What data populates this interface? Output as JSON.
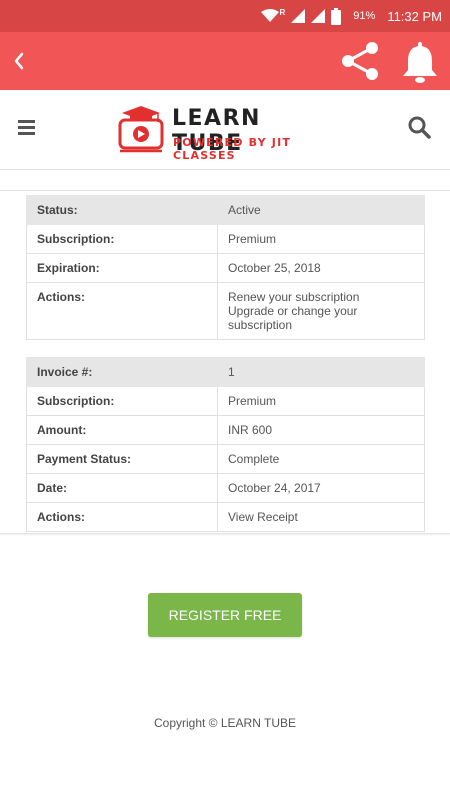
{
  "status_bar": {
    "battery": "91%",
    "time": "11:32 PM",
    "network_badge": "R"
  },
  "app_bar": {
    "back_icon": "chevron-left-icon",
    "share_icon": "share-icon",
    "bell_icon": "bell-icon",
    "background": "#f25555"
  },
  "header": {
    "logo_title": "LEARN TUBE",
    "logo_subtitle": "POWERED BY JIT CLASSES",
    "menu_icon": "hamburger-icon",
    "search_icon": "search-icon"
  },
  "subscription_table": {
    "rows": [
      {
        "label": "Status:",
        "value": "Active"
      },
      {
        "label": "Subscription:",
        "value": "Premium"
      },
      {
        "label": "Expiration:",
        "value": "October 25, 2018"
      }
    ],
    "actions_label": "Actions:",
    "actions": [
      "Renew your subscription",
      "Upgrade or change your subscription"
    ]
  },
  "invoice_table": {
    "rows": [
      {
        "label": "Invoice #:",
        "value": "1"
      },
      {
        "label": "Subscription:",
        "value": "Premium"
      },
      {
        "label": "Amount:",
        "value": "INR 600"
      },
      {
        "label": "Payment Status:",
        "value": "Complete"
      },
      {
        "label": "Date:",
        "value": "October 24, 2017"
      },
      {
        "label": "Actions:",
        "value": "View Receipt"
      }
    ]
  },
  "register_button": {
    "label": "REGISTER FREE",
    "color": "#7ab648"
  },
  "footer": {
    "copyright": "Copyright © LEARN TUBE"
  }
}
